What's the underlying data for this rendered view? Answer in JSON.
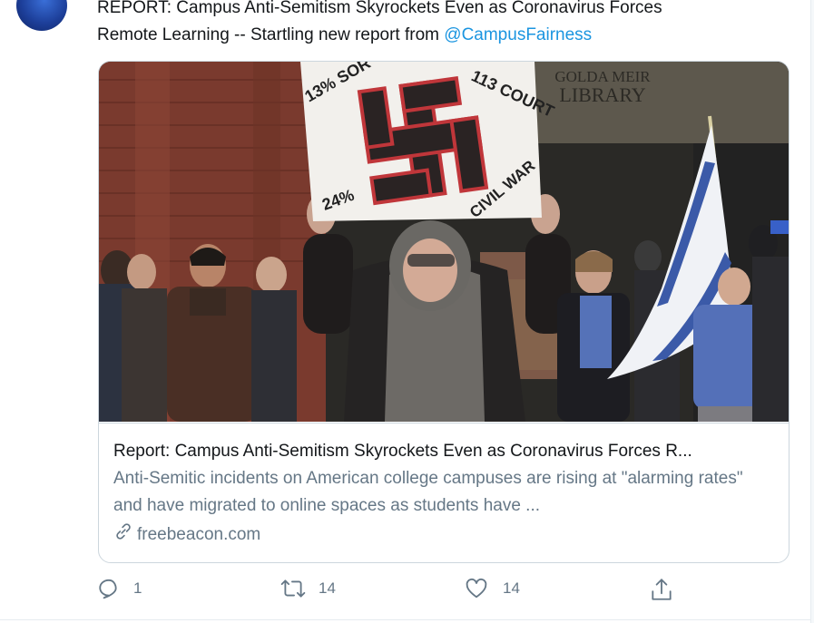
{
  "tweet": {
    "text_line1": "REPORT: Campus Anti-Semitism Skyrockets Even as Coronavirus Forces",
    "text_line2_prefix": "Remote Learning -- Startling new report from ",
    "mention": "@CampusFairness"
  },
  "card": {
    "title": "Report: Campus Anti-Semitism Skyrockets Even as Coronavirus Forces R...",
    "description": "Anti-Semitic incidents on American college campuses are rising at \"alarming rates\" and have migrated to online spaces as students have ...",
    "domain": "freebeacon.com",
    "image_sign": {
      "top_left": "13% SOR",
      "top_right": "113 COURT",
      "bottom_left": "24%",
      "bottom_right": "CIVIL WAR"
    },
    "building_sign": {
      "line1": "GOLDA MEIR",
      "line2": "LIBRARY"
    }
  },
  "actions": {
    "reply_count": "1",
    "retweet_count": "14",
    "like_count": "14"
  },
  "colors": {
    "link": "#1b95e0",
    "muted": "#657786",
    "border": "#ccd6dd"
  }
}
